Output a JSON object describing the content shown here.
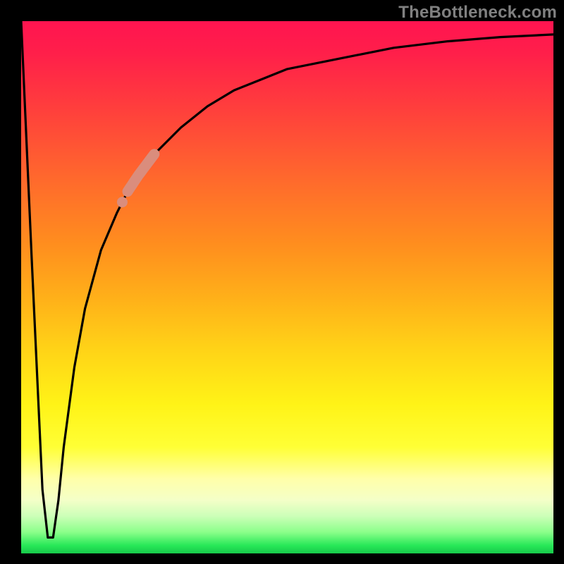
{
  "watermark": "TheBottleneck.com",
  "colors": {
    "black": "#000000",
    "curve": "#000000",
    "highlight": "#da8d7d",
    "gradient_top": "#ff1450",
    "gradient_mid": "#ffd417",
    "gradient_bottom": "#17c94a",
    "watermark": "#808080"
  },
  "chart_data": {
    "type": "line",
    "title": "",
    "xlabel": "",
    "ylabel": "",
    "xlim": [
      0,
      100
    ],
    "ylim": [
      0,
      100
    ],
    "grid": false,
    "legend": false,
    "annotations": [
      {
        "kind": "highlight-segment",
        "x_range": [
          20,
          25
        ],
        "note": "thick salmon highlight on curve"
      },
      {
        "kind": "highlight-dot",
        "x": 19,
        "note": "small salmon dot just below main highlight"
      }
    ],
    "series": [
      {
        "name": "bottleneck-curve",
        "x": [
          0,
          2,
          4,
          5,
          6,
          7,
          8,
          10,
          12,
          15,
          18,
          20,
          22,
          25,
          30,
          35,
          40,
          50,
          60,
          70,
          80,
          90,
          100
        ],
        "values": [
          100,
          55,
          12,
          3,
          3,
          10,
          20,
          35,
          46,
          57,
          64,
          68,
          71,
          75,
          80,
          84,
          87,
          91,
          93,
          95,
          96.2,
          97,
          97.5
        ]
      }
    ],
    "background_gradient_stops": [
      {
        "pos": 0.0,
        "color": "#ff1450"
      },
      {
        "pos": 0.3,
        "color": "#ff6a2c"
      },
      {
        "pos": 0.62,
        "color": "#ffd417"
      },
      {
        "pos": 0.86,
        "color": "#ffffaa"
      },
      {
        "pos": 0.96,
        "color": "#8bff8a"
      },
      {
        "pos": 1.0,
        "color": "#17c94a"
      }
    ]
  }
}
